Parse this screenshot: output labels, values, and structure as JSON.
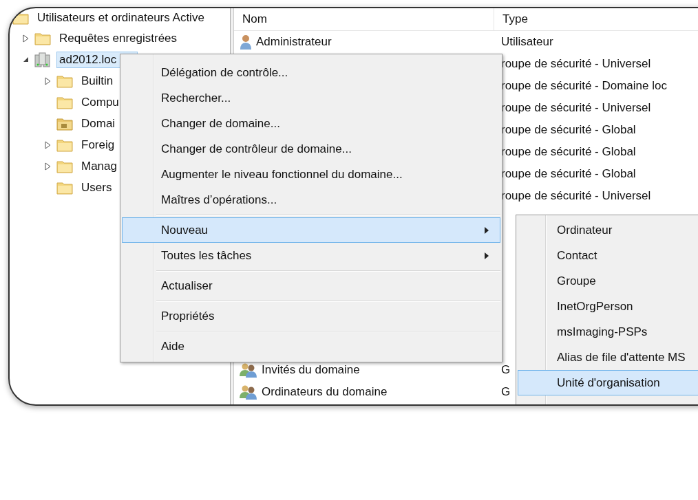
{
  "tree": {
    "label": "Utilisateurs et ordinateurs Active",
    "kind": "folder",
    "selected": false,
    "children": [
      {
        "label": "Requêtes enregistrées",
        "kind": "folder",
        "expanded": false,
        "selected": false
      },
      {
        "label": "ad2012.loc",
        "kind": "domain",
        "expanded": true,
        "selected": true,
        "children": [
          {
            "label": "Builtin",
            "kind": "folder",
            "expanded": false,
            "selected": false
          },
          {
            "label": "Compu",
            "kind": "folder",
            "selected": false
          },
          {
            "label": "Domai",
            "kind": "ou",
            "selected": false
          },
          {
            "label": "Foreig",
            "kind": "folder",
            "expanded": false,
            "selected": false
          },
          {
            "label": "Manag",
            "kind": "folder",
            "expanded": false,
            "selected": false
          },
          {
            "label": "Users",
            "kind": "folder",
            "selected": false
          }
        ]
      }
    ]
  },
  "list": {
    "columns": [
      "Nom",
      "Type"
    ],
    "rows_top": [
      {
        "kind": "user",
        "name": "Administrateur",
        "type": "Utilisateur"
      },
      {
        "type": "roupe de sécurité - Universel"
      },
      {
        "type": "roupe de sécurité - Domaine loc"
      },
      {
        "type": "roupe de sécurité - Universel"
      },
      {
        "type": "roupe de sécurité - Global"
      },
      {
        "type": "roupe de sécurité - Global"
      },
      {
        "type": "roupe de sécurité - Global"
      },
      {
        "type": "roupe de sécurité - Universel"
      }
    ],
    "rows_bottom": [
      {
        "kind": "group",
        "name": "Invités du domaine",
        "type": "G"
      },
      {
        "kind": "group",
        "name": "Ordinateurs du domaine",
        "type": "G"
      }
    ]
  },
  "context_menu": [
    {
      "kind": "item",
      "label": "Délégation de contrôle...",
      "selected": false,
      "submenu": false
    },
    {
      "kind": "item",
      "label": "Rechercher...",
      "selected": false,
      "submenu": false
    },
    {
      "kind": "item",
      "label": "Changer de domaine...",
      "selected": false,
      "submenu": false
    },
    {
      "kind": "item",
      "label": "Changer de contrôleur de domaine...",
      "selected": false,
      "submenu": false
    },
    {
      "kind": "item",
      "label": "Augmenter le niveau fonctionnel du domaine...",
      "selected": false,
      "submenu": false
    },
    {
      "kind": "item",
      "label": "Maîtres d’opérations...",
      "selected": false,
      "submenu": false
    },
    {
      "kind": "separator"
    },
    {
      "kind": "item",
      "label": "Nouveau",
      "selected": true,
      "submenu": true
    },
    {
      "kind": "item",
      "label": "Toutes les tâches",
      "selected": false,
      "submenu": true
    },
    {
      "kind": "separator"
    },
    {
      "kind": "item",
      "label": "Actualiser",
      "selected": false,
      "submenu": false
    },
    {
      "kind": "separator"
    },
    {
      "kind": "item",
      "label": "Propriétés",
      "selected": false,
      "submenu": false
    },
    {
      "kind": "separator"
    },
    {
      "kind": "item",
      "label": "Aide",
      "selected": false,
      "submenu": false
    }
  ],
  "submenu": [
    {
      "label": "Ordinateur",
      "selected": false
    },
    {
      "label": "Contact",
      "selected": false
    },
    {
      "label": "Groupe",
      "selected": false
    },
    {
      "label": "InetOrgPerson",
      "selected": false
    },
    {
      "label": "msImaging-PSPs",
      "selected": false
    },
    {
      "label": "Alias de file d'attente MS",
      "selected": false
    },
    {
      "label": "Unité d'organisation",
      "selected": true
    }
  ]
}
